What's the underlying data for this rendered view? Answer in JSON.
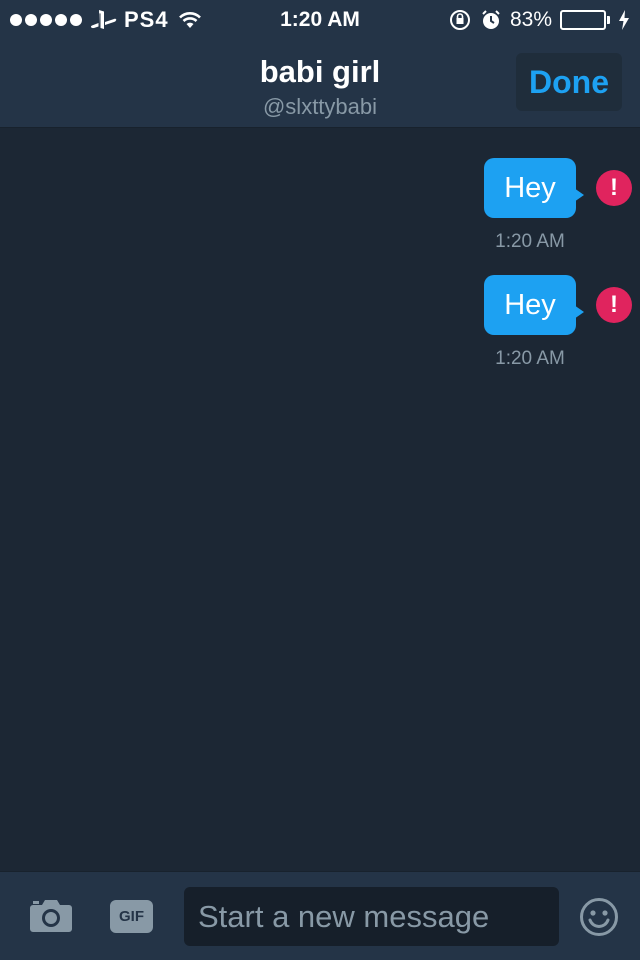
{
  "status_bar": {
    "carrier": "PS4",
    "time": "1:20 AM",
    "battery_percent": "83%",
    "battery_level": 0.83,
    "battery_color": "#4cd964"
  },
  "header": {
    "title": "babi girl",
    "handle": "@slxttybabi",
    "done_label": "Done"
  },
  "messages": [
    {
      "text": "Hey",
      "time": "1:20 AM",
      "status_icon": "error-icon",
      "status_glyph": "!"
    },
    {
      "text": "Hey",
      "time": "1:20 AM",
      "status_icon": "error-icon",
      "status_glyph": "!"
    }
  ],
  "composer": {
    "placeholder": "Start a new message",
    "gif_label": "GIF",
    "camera_icon": "camera-icon",
    "emoji_icon": "emoji-icon"
  },
  "colors": {
    "accent": "#1da1f2",
    "error": "#e0245e",
    "background": "#1c2734",
    "bar": "#243447",
    "muted": "#8899a6"
  }
}
